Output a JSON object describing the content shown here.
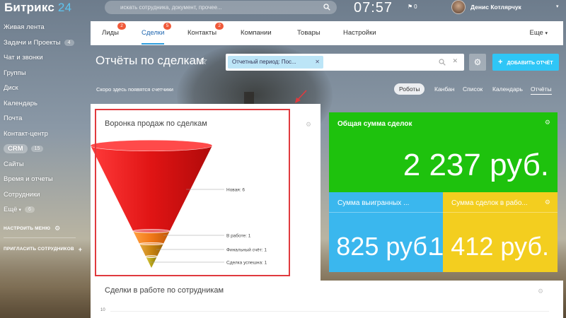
{
  "header": {
    "logo_main": "Битрикс",
    "logo_accent": "24",
    "search_placeholder": "искать сотрудника, документ, прочее...",
    "clock": "07:57",
    "flag_count": "0",
    "username": "Денис Котлярчук"
  },
  "sidebar": {
    "items": [
      {
        "label": "Живая лента",
        "badge": ""
      },
      {
        "label": "Задачи и Проекты",
        "badge": "4"
      },
      {
        "label": "Чат и звонки",
        "badge": ""
      },
      {
        "label": "Группы",
        "badge": ""
      },
      {
        "label": "Диск",
        "badge": ""
      },
      {
        "label": "Календарь",
        "badge": ""
      },
      {
        "label": "Почта",
        "badge": ""
      },
      {
        "label": "Контакт-центр",
        "badge": ""
      },
      {
        "label": "CRM",
        "badge": "15"
      },
      {
        "label": "Сайты",
        "badge": ""
      },
      {
        "label": "Время и отчеты",
        "badge": ""
      },
      {
        "label": "Сотрудники",
        "badge": ""
      },
      {
        "label": "Ещё",
        "badge": "6"
      }
    ],
    "configure_menu": "НАСТРОИТЬ МЕНЮ",
    "invite": "ПРИГЛАСИТЬ СОТРУДНИКОВ"
  },
  "tabs": [
    {
      "label": "Лиды",
      "count": "2"
    },
    {
      "label": "Сделки",
      "count": "5"
    },
    {
      "label": "Контакты",
      "count": "2"
    },
    {
      "label": "Компании",
      "count": ""
    },
    {
      "label": "Товары",
      "count": ""
    },
    {
      "label": "Настройки",
      "count": ""
    }
  ],
  "tab_more": "Еще",
  "page": {
    "title": "Отчёты по сделкам",
    "filter_chip": "Отчетный период: Пос...",
    "add_report": "ДОБАВИТЬ ОТЧЁТ",
    "soon_text": "Скоро здесь появятся счетчики"
  },
  "views": [
    {
      "label": "Роботы"
    },
    {
      "label": "Канбан"
    },
    {
      "label": "Список"
    },
    {
      "label": "Календарь"
    },
    {
      "label": "Отчёты"
    }
  ],
  "funnel": {
    "title": "Воронка продаж по сделкам",
    "stages": [
      {
        "label": "Новая: 6",
        "value": 6,
        "color": "#e41a1a"
      },
      {
        "label": "В работе: 1",
        "value": 1,
        "color": "#f07818"
      },
      {
        "label": "Финальный счёт: 1",
        "value": 1,
        "color": "#c88410"
      },
      {
        "label": "Сделка успешна: 1",
        "value": 1,
        "color": "#b8a214"
      }
    ]
  },
  "stats": {
    "total_title": "Общая сумма сделок",
    "total_value": "2 237 руб.",
    "won_title": "Сумма выигранных ...",
    "won_value": "825 руб.",
    "work_title": "Сумма сделок в рабо...",
    "work_value": "1 412 руб."
  },
  "bottom": {
    "title": "Сделки в работе по сотрудникам",
    "axis_tick": "10"
  },
  "colors": {
    "green": "#1ec20d",
    "blue": "#3ab7ee",
    "yellow": "#f3ce1f",
    "highlight": "#e03a3e",
    "accent": "#2fc6f6"
  }
}
